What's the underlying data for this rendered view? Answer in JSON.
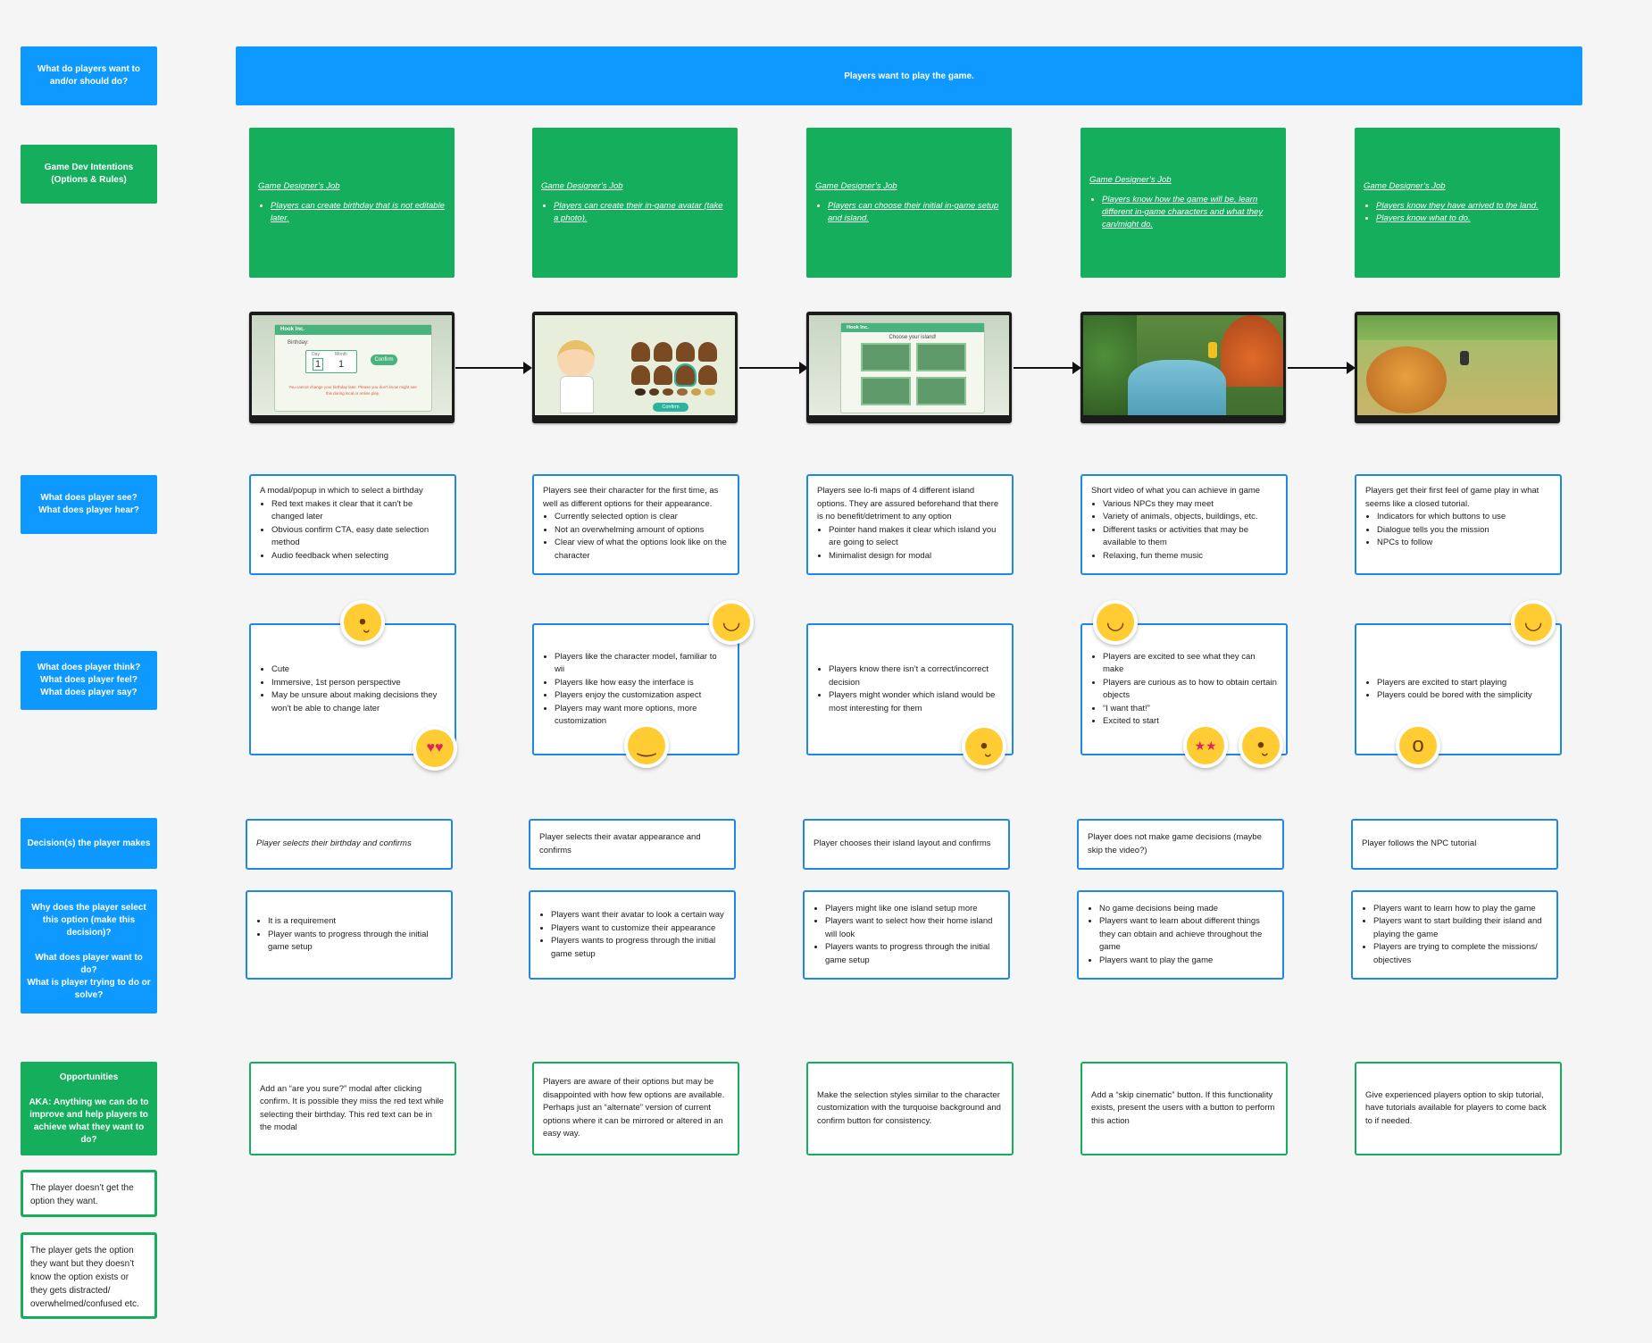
{
  "rows": [
    {
      "label": "What do players want to\nand/or should do?"
    },
    {
      "label": "Game Dev Intentions\n(Options & Rules)"
    },
    {
      "label": "What does player see?\nWhat does player hear?"
    },
    {
      "label": "What does player think?\nWhat does player feel?\nWhat does player say?"
    },
    {
      "label": "Decision(s) the player makes"
    },
    {
      "label": "Why does the player select this option (make this decision)?\n\nWhat does player want to do?\nWhat is player trying to do or solve?"
    },
    {
      "label": "Opportunities\n\nAKA: Anything we can do to improve and help players to achieve what they want to do?"
    }
  ],
  "notes": [
    "The player doesn’t get the option they want.",
    "The player gets the option they want but they doesn’t know the option exists or they gets distracted/ overwhelmed/confused etc."
  ],
  "banner": "Players want to play the game.",
  "columns": [
    {
      "gd_title": "Game Designer’s Job",
      "gd_items": [
        "Players can create birthday that is not editable later."
      ],
      "screenshot": {
        "header": "Hook Inc.",
        "label": "Birthday:",
        "day_label": "Day",
        "month_label": "Month",
        "day": "1",
        "month": "1",
        "button": "Confirm",
        "warning": "You cannot change your birthday later. Please you don't know might see this during local or online play."
      },
      "see_intro": "A modal/popup in which to select a birthday",
      "see_items": [
        "Red text makes it clear that it can't be changed later",
        "Obvious confirm CTA, easy date selection method",
        "Audio feedback when selecting"
      ],
      "think_intro": "",
      "think_items": [
        "Cute",
        "Immersive, 1st person perspective",
        "May be unsure about making decisions they won't be able to change later"
      ],
      "emotions": [
        "thinking-face-icon",
        "heart-eyes-face-icon"
      ],
      "decision": "Player selects their birthday and confirms",
      "why_items": [
        "It is a requirement",
        "Player wants to progress through the initial game setup"
      ],
      "opportunity": "Add an “are you sure?” modal after clicking confirm. It is possible they miss the red text while selecting their birthday. This red text can be in the modal"
    },
    {
      "gd_title": "Game Designer’s Job",
      "gd_items": [
        "Players can create their in-game avatar (take a photo)."
      ],
      "screenshot": {
        "button": "Confirm"
      },
      "see_intro": "Players see their character for the first time, as well as different options for their appearance.",
      "see_items": [
        "Currently selected option is clear",
        "Not an overwhelming amount of options",
        "Clear view of what the options look like on the character"
      ],
      "think_intro": "",
      "think_items": [
        "Players like the character model, familiar to wii",
        "Players like how easy the interface is",
        "Players enjoy the customization aspect",
        "Players may want more options, more customization"
      ],
      "emotions": [
        "grinning-face-icon",
        "slightly-smiling-face-icon"
      ],
      "decision": "Player selects their avatar appearance and confirms",
      "why_items": [
        "Players want their avatar to look a certain way",
        "Players want to customize their appearance",
        "Players wants to progress through the initial game setup"
      ],
      "opportunity": "Players are aware of their options but may be disappointed with how few options are available. Perhaps just an “alternate” version of current options where it can be mirrored or altered in an easy way."
    },
    {
      "gd_title": "Game Designer’s Job",
      "gd_items": [
        "Players can choose their initial in-game setup and island."
      ],
      "screenshot": {
        "header": "Hook Inc.",
        "label": "Choose your island!"
      },
      "see_intro": "Players see lo-fi maps of 4 different island options. They are assured beforehand that there is no benefit/detriment to any option",
      "see_items": [
        "Pointer hand makes it clear which island you are going to select",
        "Minimalist design for modal"
      ],
      "think_intro": "",
      "think_items": [
        "Players know there isn’t a correct/incorrect decision",
        "Players might wonder which island would be most interesting for them"
      ],
      "emotions": [
        "thinking-face-icon"
      ],
      "decision": "Player chooses their island layout and confirms",
      "why_items": [
        "Players might like one island setup more",
        "Players want to select how their home island will look",
        "Players wants to progress through the initial game setup"
      ],
      "opportunity": "Make the selection styles similar to the character customization with the turquoise background and confirm button for consistency."
    },
    {
      "gd_title": "Game Designer’s Job",
      "gd_items": [
        "Players know how the game will be, learn different in-game characters and what they can/might do."
      ],
      "screenshot": {},
      "see_intro": "Short video of what you can achieve in game",
      "see_items": [
        "Various NPCs they may meet",
        "Variety of animals, objects, buildings, etc.",
        "Different tasks or activities that may be available to them",
        "Relaxing, fun theme music"
      ],
      "think_intro": "",
      "think_items": [
        "Players are excited to see what they can make",
        "Players are curious as to how to obtain certain objects",
        "“I want that!”",
        "Excited to start"
      ],
      "emotions": [
        "grinning-squinting-face-icon",
        "star-struck-face-icon",
        "thinking-face-icon"
      ],
      "decision": "Player does not make game decisions (maybe skip the video?)",
      "why_items": [
        "No game decisions being made",
        "Players want to learn about different things they can obtain and achieve throughout the game",
        "Players want to play the game"
      ],
      "opportunity": "Add a “skip cinematic” button. If this functionality exists, present the users with a button to perform this action"
    },
    {
      "gd_title": "Game Designer’s Job",
      "gd_items": [
        "Players know they have arrived to the land.",
        "Players know what to do."
      ],
      "screenshot": {},
      "see_intro": "Players get their first feel of game play in what seems like a closed tutorial.",
      "see_items": [
        "Indicators for which buttons to use",
        "Dialogue tells you the mission",
        "NPCs to follow"
      ],
      "think_intro": "",
      "think_items": [
        "Players are excited to start playing",
        "Players could be bored with the simplicity"
      ],
      "emotions": [
        "grinning-squinting-face-icon",
        "yawning-face-icon"
      ],
      "decision": "Player follows the NPC tutorial",
      "why_items": [
        "Players want to learn how to play the game",
        "Players want to start building their island and playing the game",
        "Players are trying to complete the missions/ objectives"
      ],
      "opportunity": "Give experienced players option to skip tutorial, have tutorials available for players to come back to if needed."
    }
  ],
  "colors": {
    "blue": "#0d99ff",
    "green": "#14ae5c",
    "card_blue_border": "#1e88e5",
    "emoji_yellow": "#ffcc33"
  }
}
